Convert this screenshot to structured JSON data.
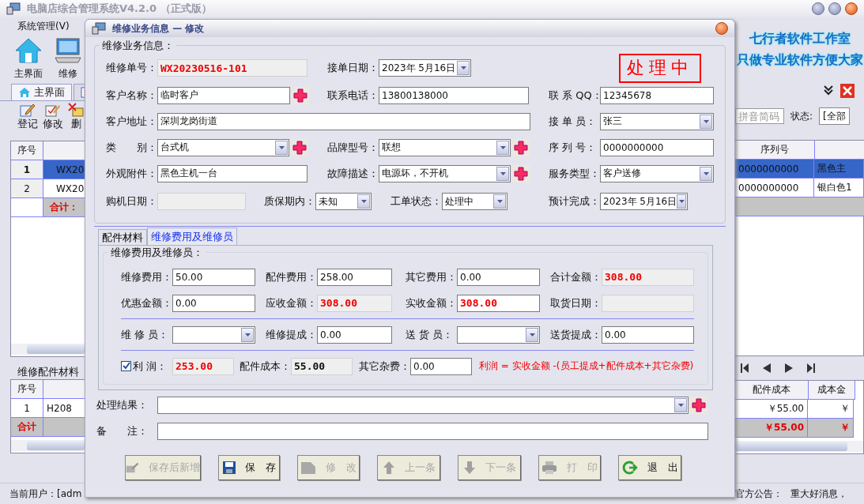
{
  "main_window": {
    "title": "电脑店综合管理系统V4.2.0 （正式版）",
    "menu": [
      "系统管理(V)"
    ],
    "toolbar": [
      {
        "label": "主界面",
        "kind": "home"
      },
      {
        "label": "维修",
        "kind": "computer"
      }
    ],
    "slogan": [
      "七行者软件工作室",
      "只做专业软件方便大家"
    ],
    "tabs": [
      {
        "label": "主界面",
        "kind": "home",
        "selected": true
      },
      {
        "kind": "list",
        "selected": false
      }
    ],
    "actions": [
      {
        "label": "登记",
        "kind": "register"
      },
      {
        "label": "修改",
        "kind": "edit"
      },
      {
        "label": "删",
        "kind": "delete"
      }
    ],
    "search": {
      "placeholder": "拼音简码"
    },
    "status_filter": {
      "label": "状态:",
      "value": "[全部"
    },
    "orders_table": {
      "columns": [
        "序号"
      ],
      "rows": [
        {
          "cells": [
            "1",
            "WX20"
          ],
          "selected": true
        },
        {
          "cells": [
            "2",
            "WX20"
          ],
          "selected": false
        }
      ],
      "total_label": "合计："
    },
    "orders_table_right": {
      "columns": [
        "序列号"
      ],
      "rows": [
        {
          "cells": [
            "0000000000",
            "黑色主"
          ],
          "selected": true
        },
        {
          "cells": [
            "0000000000",
            "银白色1"
          ],
          "selected": false
        }
      ]
    },
    "parts_title": "维修配件材料",
    "parts_table": {
      "columns": [
        "序号"
      ],
      "rows": [
        [
          "1",
          "H208"
        ]
      ],
      "total_label": "合计"
    },
    "parts_table_right": {
      "columns": [
        "配件成本",
        "成本金"
      ],
      "rows": [
        [
          "￥55.00",
          "￥"
        ]
      ],
      "totals": [
        "￥55.00",
        "￥"
      ]
    },
    "status_bar": [
      "当前用户：[adm",
      "官方公告：",
      "重大好消息，"
    ]
  },
  "dialog": {
    "title": "维修业务信息 — 修改",
    "section_title": "维修业务信息：",
    "stamp": "处理中",
    "fields": [
      {
        "label": "维修单号：",
        "kind": "readonly",
        "value": "WX20230516-101",
        "warning": true
      },
      {
        "label": "接单日期：",
        "kind": "date",
        "value": "2023年 5月16日"
      },
      {
        "label": "客户名称：",
        "kind": "text",
        "value": "临时客户",
        "add": true
      },
      {
        "label": "联系电话：",
        "kind": "text",
        "value": "13800138000"
      },
      {
        "label": "联 系 QQ：",
        "kind": "text",
        "value": "12345678"
      },
      {
        "label": "客户地址：",
        "kind": "text",
        "value": "深圳龙岗街道"
      },
      {
        "label": "接 单 员：",
        "kind": "combo",
        "value": "张三"
      },
      {
        "label": "类　　别：",
        "kind": "combo",
        "value": "台式机",
        "add": true
      },
      {
        "label": "品牌型号：",
        "kind": "combo",
        "value": "联想",
        "add": true
      },
      {
        "label": "序 列 号：",
        "kind": "text",
        "value": "0000000000"
      },
      {
        "label": "外观附件：",
        "kind": "text",
        "value": "黑色主机一台"
      },
      {
        "label": "故障描述：",
        "kind": "combo",
        "value": "电源坏，不开机",
        "add": true
      },
      {
        "label": "服务类型：",
        "kind": "combo",
        "value": "客户送修"
      },
      {
        "label": "购机日期：",
        "kind": "readonly"
      },
      {
        "label": "质保期内：",
        "kind": "combo",
        "value": "未知"
      },
      {
        "label": "工单状态：",
        "kind": "combo",
        "value": "处理中"
      },
      {
        "label": "预计完成：",
        "kind": "date",
        "value": "2023年 5月16日"
      }
    ],
    "tabs": [
      {
        "label": "配件材料",
        "selected": false
      },
      {
        "label": "维修费用及维修员",
        "selected": true
      }
    ],
    "cost_title": "维修费用及维修员：",
    "cost_rows": [
      [
        {
          "label": "维修费用：",
          "kind": "text",
          "value": "50.00"
        },
        {
          "label": "配件费用：",
          "kind": "text",
          "value": "258.00"
        },
        {
          "label": "其它费用：",
          "kind": "text",
          "value": "0.00"
        },
        {
          "label": "合计金额：",
          "kind": "readonly",
          "value": "308.00",
          "warning": true
        }
      ],
      [
        {
          "label": "优惠金额：",
          "kind": "text",
          "value": "0.00"
        },
        {
          "label": "应收金额：",
          "kind": "readonly",
          "value": "308.00",
          "warning": true
        },
        {
          "label": "实收金额：",
          "kind": "text",
          "value": "308.00",
          "warning": true
        },
        {
          "label": "取货日期：",
          "kind": "readonly"
        }
      ],
      [
        {
          "label": "维 修 员：",
          "kind": "combo"
        },
        {
          "label": "维修提成：",
          "kind": "text",
          "value": "0.00"
        },
        {
          "label": "送 货 员：",
          "kind": "combo"
        },
        {
          "label": "送货提成：",
          "kind": "text",
          "value": "0.00"
        }
      ]
    ],
    "profit_row": {
      "label": "利 润：",
      "checked": true,
      "fields": [
        {
          "kind": "readonly",
          "value": "253.00",
          "warning": true
        },
        {
          "label": "配件成本：",
          "kind": "readonly",
          "value": "55.00",
          "strong": true
        },
        {
          "label": "其它杂费：",
          "kind": "text",
          "value": "0.00"
        }
      ],
      "formula": "利润 = 实收金额 -(员工提成+配件成本+其它杂费)"
    },
    "result": {
      "label": "处理结果：",
      "kind": "combo",
      "add": true
    },
    "note": {
      "label": "备　　注：",
      "kind": "text"
    },
    "buttons": [
      {
        "label": "保存后新增",
        "kind": "save-new",
        "disabled": true
      },
      {
        "label": "保　存",
        "kind": "save",
        "disabled": false
      },
      {
        "label": "修　改",
        "kind": "edit",
        "disabled": true
      },
      {
        "label": "上一条",
        "kind": "up",
        "disabled": true
      },
      {
        "label": "下一条",
        "kind": "down",
        "disabled": true
      },
      {
        "label": "打　印",
        "kind": "print",
        "disabled": true
      },
      {
        "label": "退　出",
        "kind": "exit",
        "disabled": false
      }
    ]
  }
}
